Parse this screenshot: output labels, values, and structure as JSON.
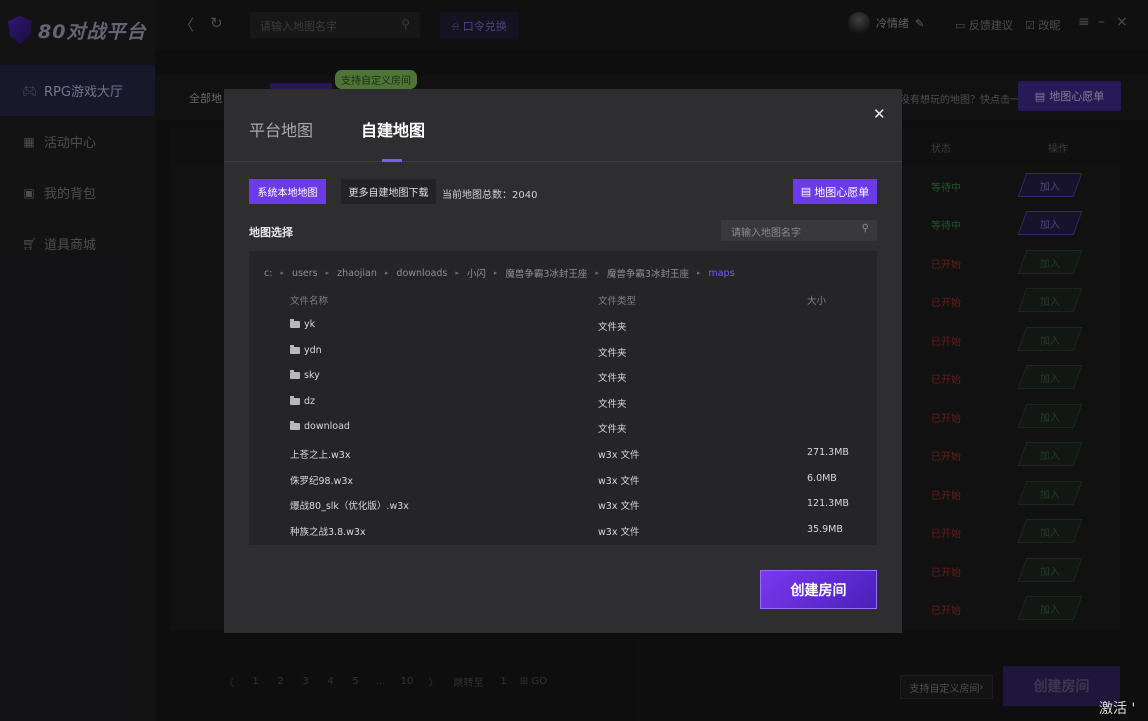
{
  "app": {
    "logo": "80对战平台"
  },
  "sidebar": {
    "items": [
      {
        "label": "RPG游戏大厅",
        "icon": "gamepad-icon"
      },
      {
        "label": "活动中心",
        "icon": "gift-icon"
      },
      {
        "label": "我的背包",
        "icon": "backpack-icon"
      },
      {
        "label": "道具商城",
        "icon": "cart-icon"
      }
    ]
  },
  "topbar": {
    "search_placeholder": "请输入地图名字",
    "command": "口令兑换",
    "username": "冷情绪",
    "feedback": "反馈建议",
    "nickname_change": "改昵",
    "colors": {
      "accent": "#7b5cf0"
    }
  },
  "lobby": {
    "all_label": "全部地",
    "custom_room_badge": "支持自定义房间",
    "wish_question": "没有想玩的地图？快点击一键申请！",
    "wish_button": "地图心愿单",
    "status_header": "状态",
    "op_header": "操作",
    "rows": [
      {
        "status": "等待中",
        "op": "加入",
        "kind": "wait"
      },
      {
        "status": "等待中",
        "op": "加入",
        "kind": "wait"
      },
      {
        "status": "已开始",
        "op": "加入",
        "kind": "start"
      },
      {
        "status": "已开始",
        "op": "加入",
        "kind": "start"
      },
      {
        "status": "已开始",
        "op": "加入",
        "kind": "start"
      },
      {
        "status": "已开始",
        "op": "加入",
        "kind": "start"
      },
      {
        "status": "已开始",
        "op": "加入",
        "kind": "start"
      },
      {
        "status": "已开始",
        "op": "加入",
        "kind": "start"
      },
      {
        "status": "已开始",
        "op": "加入",
        "kind": "start"
      },
      {
        "status": "已开始",
        "op": "加入",
        "kind": "start"
      },
      {
        "status": "已开始",
        "op": "加入",
        "kind": "start"
      },
      {
        "status": "已开始",
        "op": "加入",
        "kind": "start"
      }
    ],
    "pagination": {
      "pages": [
        "1",
        "2",
        "3",
        "4",
        "5",
        "...",
        "10"
      ],
      "jump_label": "跳转至",
      "jump_value": "1",
      "go": "GO"
    },
    "custom_room_button": "支持自定义房间",
    "create_room": "创建房间"
  },
  "modal": {
    "tab_platform": "平台地图",
    "tab_custom": "自建地图",
    "btn_system_local": "系统本地地图",
    "btn_more_download": "更多自建地图下载",
    "map_count_text": "当前地图总数：2040",
    "wish_button": "地图心愿单",
    "select_label": "地图选择",
    "search_placeholder": "请输入地图名字",
    "breadcrumb": [
      "c:",
      "users",
      "zhaojian",
      "downloads",
      "小闪",
      "魔兽争霸3冰封王座",
      "魔兽争霸3冰封王座",
      "maps"
    ],
    "columns": {
      "name": "文件名称",
      "type": "文件类型",
      "size": "大小"
    },
    "files": [
      {
        "name": "yk",
        "type": "文件夹",
        "size": "",
        "folder": true
      },
      {
        "name": "ydn",
        "type": "文件夹",
        "size": "",
        "folder": true
      },
      {
        "name": "sky",
        "type": "文件夹",
        "size": "",
        "folder": true
      },
      {
        "name": "dz",
        "type": "文件夹",
        "size": "",
        "folder": true
      },
      {
        "name": "download",
        "type": "文件夹",
        "size": "",
        "folder": true
      },
      {
        "name": "上苍之上.w3x",
        "type": "w3x 文件",
        "size": "271.3MB",
        "folder": false
      },
      {
        "name": "侏罗纪98.w3x",
        "type": "w3x 文件",
        "size": "6.0MB",
        "folder": false
      },
      {
        "name": "爆战80_slk（优化版）.w3x",
        "type": "w3x 文件",
        "size": "121.3MB",
        "folder": false
      },
      {
        "name": "种族之战3.8.w3x",
        "type": "w3x 文件",
        "size": "35.9MB",
        "folder": false
      }
    ],
    "create_room": "创建房间"
  },
  "watermark": "激活 '"
}
